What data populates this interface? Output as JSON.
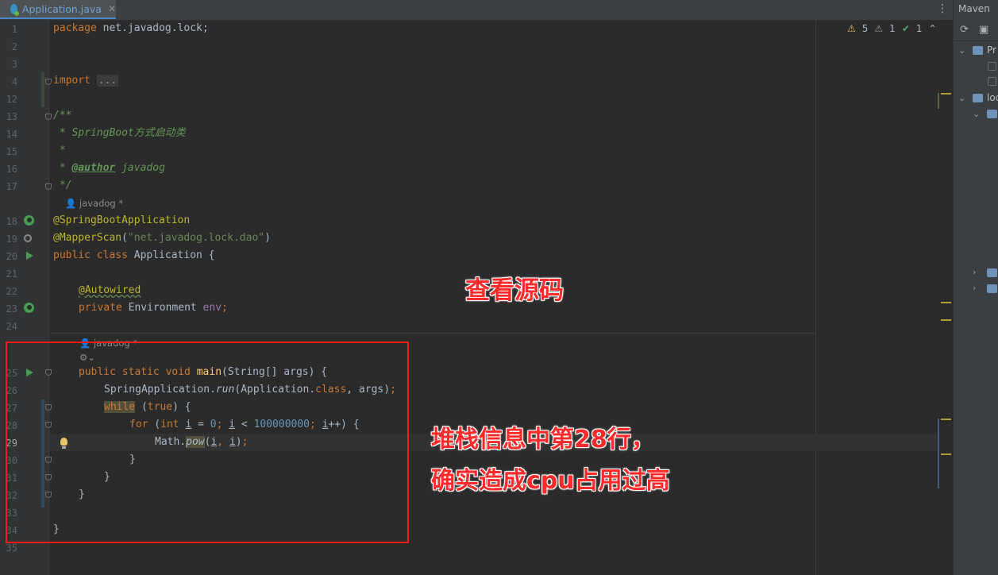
{
  "tab": {
    "label": "Application.java",
    "close": "✕",
    "menu": "⋮"
  },
  "inspections": {
    "warnings": "5",
    "weak_warnings": "1",
    "ok": "1"
  },
  "maven": {
    "title": "Maven",
    "tree_labels": [
      "Pr",
      "loc"
    ]
  },
  "line_numbers": [
    "1",
    "2",
    "3",
    "4",
    "12",
    "13",
    "14",
    "15",
    "16",
    "17",
    "18",
    "19",
    "20",
    "21",
    "22",
    "23",
    "24",
    "25",
    "26",
    "27",
    "28",
    "29",
    "30",
    "31",
    "32",
    "33",
    "34",
    "35"
  ],
  "hints": {
    "author_hint_1": "javadog *",
    "author_hint_2": "javadog *"
  },
  "code": {
    "package_kw": "package",
    "package_name": " net.javadog.lock;",
    "import_kw": "import",
    "import_fold": "...",
    "doc_open": "/**",
    "doc_line1": " * SpringBoot方式启动类",
    "doc_star": " *",
    "doc_author_prefix": " * ",
    "doc_author_tag": "@author",
    "doc_author_name": " javadog",
    "doc_close": " */",
    "ann_boot": "@SpringBootApplication",
    "ann_mapper": "@MapperScan",
    "mapper_open": "(",
    "mapper_str": "\"net.javadog.lock.dao\"",
    "mapper_close": ")",
    "class_kw": "public class",
    "class_name": " Application {",
    "ann_autowired": "@Autowired",
    "field_kw": "private",
    "field_type": " Environment ",
    "field_name": "env",
    "field_semi": ";",
    "main_kw": "public static void",
    "main_name": "main",
    "main_sig": "(String[] args) {",
    "run_cls": "SpringApplication.",
    "run_method": "run",
    "run_args1": "(Application.",
    "run_class_kw": "class",
    "run_args2": ", args)",
    "run_semi": ";",
    "while_kw": "while",
    "while_open": " (",
    "while_true": "true",
    "while_close": ") {",
    "for_kw": "for",
    "for_open": " (",
    "for_int": "int",
    "for_i1": "i",
    "for_eq": " = ",
    "for_zero": "0",
    "for_semi1": "; ",
    "for_i2": "i",
    "for_lt": " < ",
    "for_limit": "100000000",
    "for_semi2": "; ",
    "for_i3": "i",
    "for_inc": "++) {",
    "math_cls": "Math.",
    "math_pow": "pow",
    "math_open": "(",
    "math_i1": "i",
    "math_comma": ", ",
    "math_i2": "i",
    "math_close": ")",
    "math_semi": ";",
    "brace1": "}",
    "brace2": "}",
    "brace3": "}",
    "brace4": "}"
  },
  "annotations": {
    "top": "查看源码",
    "bottom_line1": "堆栈信息中第28行，",
    "bottom_line2": "确实造成cpu占用过高"
  },
  "colors": {
    "overlay_red": "#ff2a2a",
    "box_red": "#ff1a1a"
  }
}
